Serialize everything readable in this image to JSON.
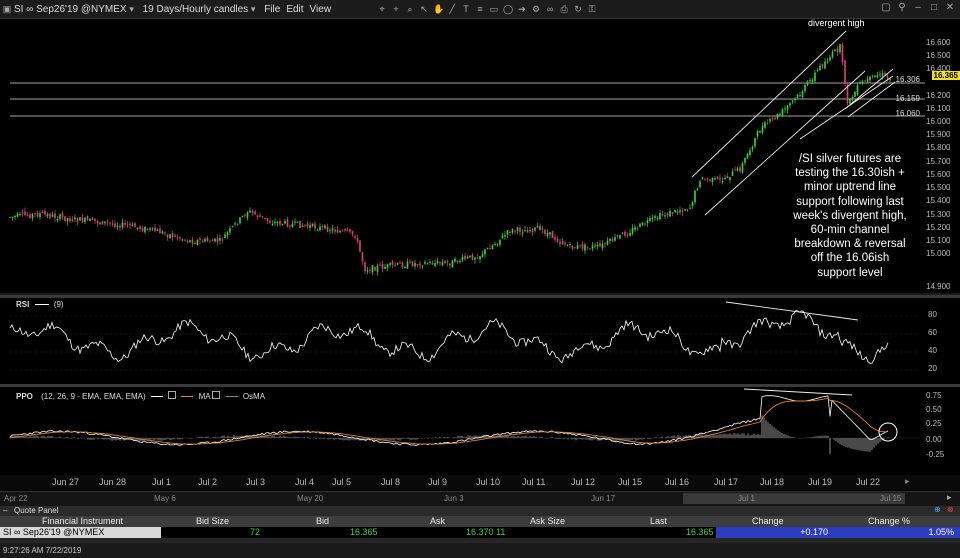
{
  "window": {
    "symbol_label": "SI ∞ Sep26'19 @NYMEX",
    "interval_label": "19 Days/Hourly candles",
    "menu": [
      "File",
      "Edit",
      "View"
    ]
  },
  "price_chart": {
    "annotation_top": "divergent high",
    "annotation_text": [
      "/SI silver futures are",
      "testing the 16.30ish +",
      "minor uptrend line",
      "support following last",
      "week's divergent high,",
      "60-min channel",
      "breakdown & reversal",
      "off the 16.06ish",
      "support level"
    ],
    "y_ticks": [
      "16.600",
      "16.500",
      "16.400",
      "16.300",
      "16.200",
      "16.100",
      "16.000",
      "15.900",
      "15.800",
      "15.700",
      "15.600",
      "15.500",
      "15.400",
      "15.300",
      "15.200",
      "15.100",
      "15.000",
      "14.900"
    ],
    "levels": [
      "16.306",
      "16.159",
      "16.060"
    ],
    "last_price": "16.365"
  },
  "rsi": {
    "title": "RSI",
    "params": "(9)",
    "y_ticks": [
      "80",
      "60",
      "40",
      "20"
    ]
  },
  "ppo": {
    "title": "PPO",
    "params": "(12, 26, 9 - EMA, EMA, EMA)",
    "ma_label": "MA",
    "osma_label": "OsMA",
    "y_ticks": [
      "0.75",
      "0.50",
      "0.25",
      "0.00",
      "-0.25"
    ]
  },
  "x_axis": {
    "labels": [
      "Jun 27",
      "Jun 28",
      "Jul 1",
      "Jul 2",
      "Jul 3",
      "Jul 4",
      "Jul 5",
      "Jul 8",
      "Jul 9",
      "Jul 10",
      "Jul 11",
      "Jul 12",
      "Jul 15",
      "Jul 16",
      "Jul 17",
      "Jul 18",
      "Jul 19",
      "Jul 22"
    ],
    "overview_labels": [
      "Apr 22",
      "May 6",
      "May 20",
      "Jun 3",
      "Jun 17",
      "Jul 1",
      "Jul 15"
    ]
  },
  "quote_panel": {
    "title": "Quote Panel",
    "columns": [
      "Financial Instrument",
      "Bid Size",
      "Bid",
      "Ask",
      "Ask Size",
      "Last",
      "Change",
      "Change %"
    ],
    "row": {
      "instrument": "SI ∞ Sep26'19 @NYMEX",
      "bid_size": "72",
      "bid": "16.365",
      "ask": "16.370",
      "ask_size": "11",
      "last": "16.365",
      "change": "+0.170",
      "change_pct": "1.05%"
    }
  },
  "status": {
    "time": "9:27:26 AM 7/22/2019"
  },
  "colors": {
    "up_candle": "#3cd43c",
    "down_candle": "#e0407a",
    "last_price_tag": "#f0e020",
    "macd_line": "#ffffff",
    "signal_line": "#e08020",
    "change_bg": "#2d3dc0"
  }
}
